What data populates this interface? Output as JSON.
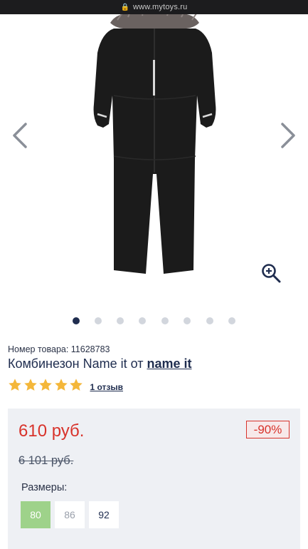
{
  "browser": {
    "url": "www.mytoys.ru",
    "lock_icon": "lock-icon"
  },
  "gallery": {
    "prev_icon": "chevron-left-icon",
    "next_icon": "chevron-right-icon",
    "zoom_icon": "zoom-in-icon",
    "slide_count": 8,
    "active_slide": 1
  },
  "product": {
    "sku_label": "Номер товара: 11628783",
    "title_prefix": "Комбинезон Name it от",
    "brand": "name it",
    "rating": 5,
    "reviews_label": "1 отзыв"
  },
  "pricing": {
    "price": "610 руб.",
    "discount": "-90%",
    "old_price": "6 101 руб."
  },
  "sizes": {
    "label": "Размеры:",
    "options": [
      {
        "label": "80",
        "state": "selected"
      },
      {
        "label": "86",
        "state": "disabled"
      },
      {
        "label": "92",
        "state": "available"
      }
    ]
  },
  "colors": {
    "accent_red": "#d8332b",
    "brand_navy": "#1f2d4f",
    "star_yellow": "#f4b73a",
    "size_selected": "#9ed28a"
  }
}
